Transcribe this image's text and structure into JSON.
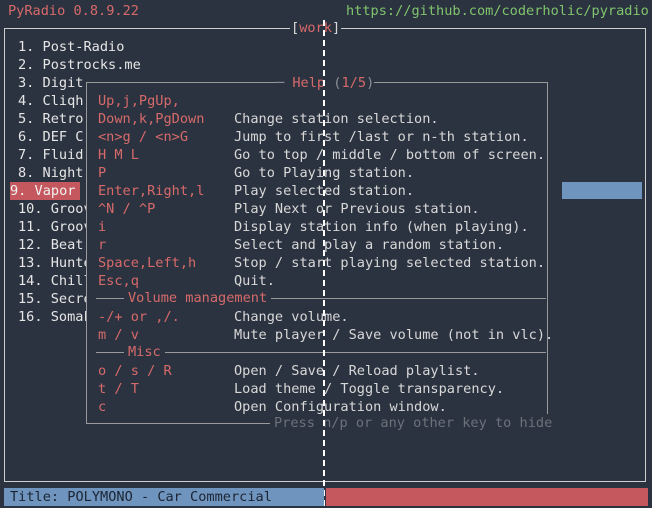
{
  "app": {
    "title": "PyRadio 0.8.9.22",
    "url": "https://github.com/coderholic/pyradio",
    "playlist": "work"
  },
  "stations": [
    {
      "label": "1. Post-Radio"
    },
    {
      "label": "2. Postrocks.me"
    },
    {
      "label": "3. Digit"
    },
    {
      "label": "4. Cliqh"
    },
    {
      "label": "5. Retro"
    },
    {
      "label": "6. DEF C"
    },
    {
      "label": "7. Fluid"
    },
    {
      "label": "8. Night"
    },
    {
      "label": "9. Vapor"
    },
    {
      "label": "10. Groov"
    },
    {
      "label": "11. Groov"
    },
    {
      "label": "12. Beat"
    },
    {
      "label": "13. Hunte"
    },
    {
      "label": "14. Chill"
    },
    {
      "label": "15. Secre"
    },
    {
      "label": "16. SomaF"
    }
  ],
  "selected_index": 8,
  "help": {
    "title": "Help",
    "page": "1/5",
    "rows": [
      {
        "key": "Up,j,PgUp,",
        "desc": ""
      },
      {
        "key": "Down,k,PgDown",
        "desc": "Change station selection."
      },
      {
        "key": "<n>g / <n>G",
        "desc": "Jump to first /last or n-th station."
      },
      {
        "key": "H M L",
        "desc": "Go to top / middle / bottom of screen."
      },
      {
        "key": "P",
        "desc": "Go to Playing station."
      },
      {
        "key": "Enter,Right,l",
        "desc": "Play selected station."
      },
      {
        "key": "^N / ^P",
        "desc": "Play Next or Previous station."
      },
      {
        "key": "i",
        "desc": "Display station info (when playing)."
      },
      {
        "key": "r",
        "desc": "Select and play a random station."
      },
      {
        "key": "Space,Left,h",
        "desc": "Stop / start playing selected station."
      },
      {
        "key": "Esc,q",
        "desc": "Quit."
      }
    ],
    "volume_section": "Volume management",
    "volume_rows": [
      {
        "key": "-/+ or ,/.",
        "desc": "Change volume."
      },
      {
        "key": "m / v",
        "desc": "Mute player / Save volume (not in vlc)."
      }
    ],
    "misc_section": "Misc",
    "misc_rows": [
      {
        "key": "o / s / R",
        "desc": "Open / Save / Reload playlist."
      },
      {
        "key": "t / T",
        "desc": "Load theme / Toggle transparency."
      },
      {
        "key": "c",
        "desc": "Open Configuration window."
      }
    ],
    "footer": "Press n/p or any other key to hide"
  },
  "status": {
    "text": "Title: POLYMONO - Car Commercial"
  },
  "colors": {
    "background": "#2c3340",
    "accent_red": "#d66a6a",
    "accent_green": "#7fc46c",
    "selection": "#c4585e",
    "status_blue": "#6f95be"
  }
}
